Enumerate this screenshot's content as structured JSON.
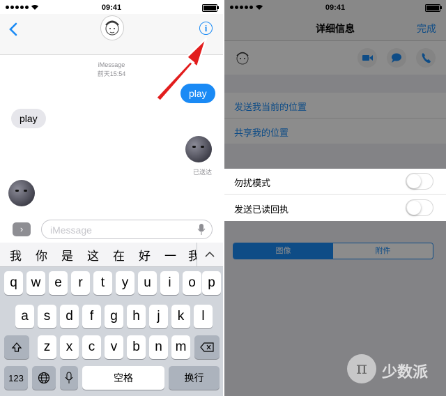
{
  "left": {
    "status": {
      "time": "09:41"
    },
    "conversation": {
      "service": "iMessage",
      "timestamp": "前天15:54",
      "messages": {
        "out_1": "play",
        "in_1": "play",
        "delivered": "已送达"
      }
    },
    "composer": {
      "placeholder": "iMessage"
    },
    "keyboard": {
      "candidates": [
        "我",
        "你",
        "是",
        "这",
        "在",
        "好",
        "一",
        "我"
      ],
      "row1": [
        "q",
        "w",
        "e",
        "r",
        "t",
        "y",
        "u",
        "i",
        "o",
        "p"
      ],
      "row2": [
        "a",
        "s",
        "d",
        "f",
        "g",
        "h",
        "j",
        "k",
        "l"
      ],
      "row3": [
        "z",
        "x",
        "c",
        "v",
        "b",
        "n",
        "m"
      ],
      "numbers_key": "123",
      "space_key": "空格",
      "return_key": "换行"
    }
  },
  "right": {
    "status": {
      "time": "09:41"
    },
    "nav": {
      "title": "详细信息",
      "done": "完成"
    },
    "links": {
      "send_location": "发送我当前的位置",
      "share_location": "共享我的位置"
    },
    "settings": {
      "dnd_label": "勿扰模式",
      "dnd_on": false,
      "read_receipts_label": "发送已读回执",
      "read_receipts_on": false
    },
    "segments": {
      "images": "图像",
      "attachments": "附件"
    },
    "watermark": {
      "glyph": "π",
      "text": "少数派"
    }
  },
  "colors": {
    "accent": "#1a8af5",
    "annotation_arrow": "#e21d1d",
    "dim_overlay": "rgba(0,0,0,0.45)"
  }
}
